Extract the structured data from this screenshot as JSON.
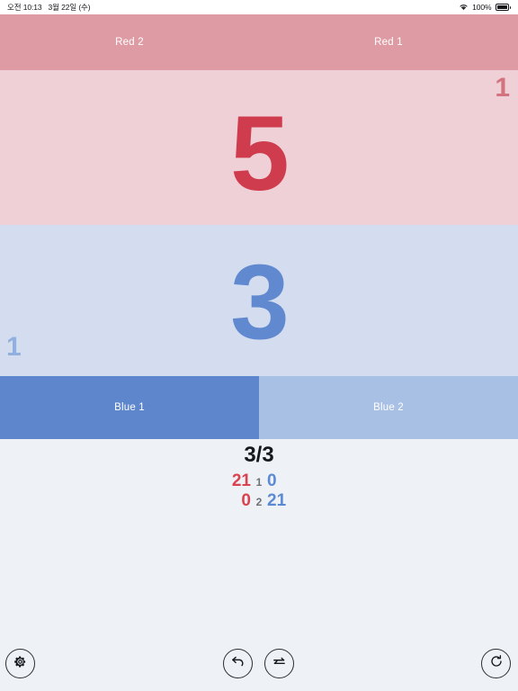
{
  "statusbar": {
    "time": "오전 10:13",
    "date": "3월 22일 (수)",
    "wifi_icon": "wifi-icon",
    "battery_percent": "100%",
    "battery_icon": "battery-full-icon"
  },
  "red_team": {
    "left_label": "Red 2",
    "right_label": "Red 1",
    "bar_color": "#df9ba4",
    "zone_color": "#efd0d6",
    "score": "5",
    "score_color": "#cf3c4d",
    "sets_won": "1",
    "sets_color": "#d3737f"
  },
  "blue_team": {
    "left_label": "Blue 1",
    "right_label": "Blue 2",
    "active_color": "#5e86cd",
    "inactive_color": "#a9c0e5",
    "zone_color": "#d4ddef",
    "score": "3",
    "score_color": "#6189cf",
    "sets_won": "1",
    "sets_color": "#92b0de"
  },
  "summary": {
    "sets_line": "3/3",
    "rows": [
      {
        "red": "21",
        "index": "1",
        "blue": "0"
      },
      {
        "red": "0",
        "index": "2",
        "blue": "21"
      }
    ]
  },
  "toolbar": {
    "settings_icon": "gear-icon",
    "undo_icon": "undo-arrow-icon",
    "swap_icon": "swap-arrows-icon",
    "reset_icon": "reset-circular-arrow-icon"
  },
  "chart_data": {
    "type": "table",
    "title": "3/3",
    "categories": [
      "1",
      "2"
    ],
    "series": [
      {
        "name": "Red",
        "values": [
          21,
          0
        ]
      },
      {
        "name": "Blue",
        "values": [
          0,
          21
        ]
      }
    ],
    "current_game": {
      "red": 5,
      "blue": 3
    },
    "sets_won": {
      "red": 1,
      "blue": 1
    }
  }
}
